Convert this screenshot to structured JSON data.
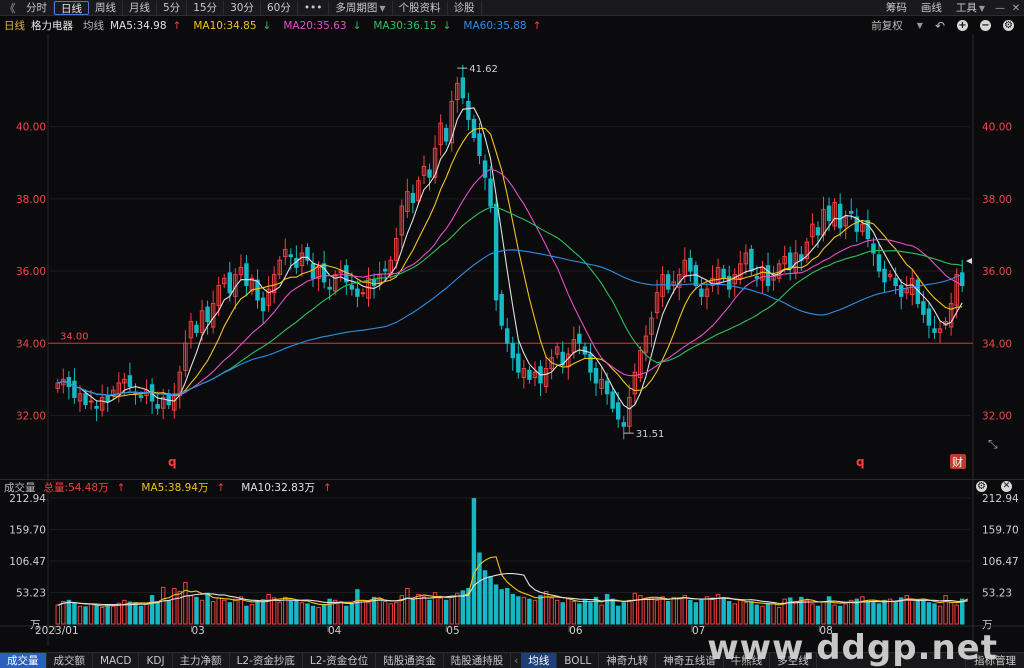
{
  "toolbar": {
    "back": "《",
    "items": [
      "分时",
      "日线",
      "周线",
      "月线",
      "5分",
      "15分",
      "30分",
      "60分",
      "•••",
      "多周期图",
      "个股资料",
      "诊股"
    ],
    "active_index": 1,
    "right_items": [
      "筹码",
      "画线",
      "工具"
    ]
  },
  "header": {
    "period": "日线",
    "stock_name": "格力电器",
    "avg_label": "均线",
    "ma": [
      {
        "label": "MA5:34.98",
        "arrow": "↑",
        "color": "#e0e0e0"
      },
      {
        "label": "MA10:34.85",
        "arrow": "↓",
        "color": "#f0c419"
      },
      {
        "label": "MA20:35.63",
        "arrow": "↓",
        "color": "#e44fc7"
      },
      {
        "label": "MA30:36.15",
        "arrow": "↓",
        "color": "#2ec05c"
      },
      {
        "label": "MA60:35.88",
        "arrow": "↑",
        "color": "#2e8fe8"
      }
    ],
    "adjust": "前复权"
  },
  "price_axis": {
    "ticks": [
      "40.00",
      "38.00",
      "36.00",
      "34.00",
      "32.00"
    ],
    "min": 30.6,
    "max": 42.4
  },
  "annotations": {
    "high": "41.62",
    "low": "31.51",
    "ref_line": "34.00",
    "q1": "q",
    "q2": "q",
    "cai": "财"
  },
  "volume": {
    "label": "成交量",
    "total": "总量:54.48万",
    "total_arrow": "↑",
    "ma5": "MA5:38.94万",
    "ma5_arrow": "↑",
    "ma10": "MA10:32.83万",
    "ma10_arrow": "↑",
    "ticks": [
      "212.94",
      "159.70",
      "106.47",
      "53.23"
    ],
    "unit": "万",
    "max": 212.94
  },
  "x_labels": [
    "2023/01",
    "03",
    "04",
    "05",
    "06",
    "07",
    "08"
  ],
  "tabs": [
    "成交量",
    "成交额",
    "MACD",
    "KDJ",
    "主力净额",
    "L2-资金抄底",
    "L2-资金仓位",
    "陆股通资金",
    "陆股通持股"
  ],
  "tabs2": [
    "均线",
    "BOLL",
    "神奇九转",
    "神奇五线谱",
    "牛熊线",
    "多空线"
  ],
  "tab_more": "指标管理",
  "watermark": "www.ddgp.net",
  "colors": {
    "up": "#f04141",
    "down": "#17b8c4",
    "ma5": "#e0e0e0",
    "ma10": "#f0c419",
    "ma20": "#e44fc7",
    "ma30": "#2ec05c",
    "ma60": "#2e8fe8"
  },
  "chart_data": {
    "type": "candlestick",
    "x_start": "2023/01",
    "ylim": [
      30.6,
      42.4
    ],
    "closes": [
      32.9,
      33.0,
      32.8,
      32.5,
      32.6,
      32.3,
      32.4,
      32.2,
      32.5,
      32.4,
      32.7,
      32.9,
      33.0,
      32.8,
      32.6,
      32.5,
      32.7,
      32.4,
      32.2,
      32.5,
      32.3,
      32.6,
      33.2,
      34.0,
      34.6,
      34.3,
      34.9,
      34.6,
      35.1,
      35.6,
      35.8,
      35.4,
      35.9,
      36.1,
      35.6,
      35.8,
      35.2,
      34.9,
      35.5,
      35.9,
      36.3,
      36.6,
      36.4,
      36.1,
      36.5,
      36.3,
      35.8,
      36.1,
      35.7,
      35.5,
      35.9,
      36.0,
      35.7,
      35.5,
      35.3,
      35.4,
      35.8,
      35.6,
      35.9,
      36.0,
      36.3,
      36.9,
      37.8,
      38.2,
      37.9,
      38.5,
      38.9,
      38.6,
      39.4,
      40.1,
      39.6,
      40.7,
      41.2,
      40.8,
      40.2,
      39.7,
      39.2,
      38.6,
      37.8,
      35.2,
      34.5,
      34.0,
      33.6,
      33.2,
      33.3,
      33.0,
      33.2,
      32.9,
      33.3,
      33.6,
      33.9,
      33.4,
      33.7,
      34.1,
      34.0,
      33.7,
      33.2,
      32.9,
      33.0,
      32.6,
      32.2,
      31.9,
      31.7,
      32.5,
      33.2,
      33.8,
      34.2,
      34.7,
      35.4,
      35.9,
      35.5,
      35.7,
      35.9,
      36.3,
      36.0,
      35.6,
      35.3,
      35.5,
      35.8,
      36.1,
      35.8,
      35.5,
      35.9,
      36.2,
      36.5,
      36.0,
      35.8,
      36.1,
      35.6,
      35.9,
      36.2,
      36.4,
      36.1,
      36.5,
      36.3,
      36.8,
      37.3,
      37.0,
      37.7,
      37.4,
      37.9,
      37.2,
      37.5,
      37.6,
      37.1,
      37.3,
      36.9,
      36.5,
      36.0,
      35.7,
      35.9,
      35.6,
      35.3,
      35.5,
      35.8,
      35.1,
      34.8,
      34.5,
      34.3,
      34.4,
      34.6,
      35.1,
      35.9,
      35.6
    ],
    "volumes": [
      32,
      38,
      40,
      35,
      30,
      29,
      34,
      31,
      28,
      33,
      30,
      35,
      40,
      37,
      36,
      30,
      34,
      48,
      38,
      62,
      39,
      60,
      55,
      70,
      48,
      45,
      40,
      52,
      38,
      44,
      40,
      36,
      42,
      46,
      30,
      33,
      38,
      41,
      50,
      44,
      37,
      45,
      40,
      39,
      36,
      34,
      30,
      28,
      33,
      42,
      40,
      38,
      30,
      33,
      58,
      40,
      36,
      45,
      42,
      38,
      34,
      36,
      48,
      60,
      42,
      50,
      46,
      40,
      53,
      44,
      40,
      47,
      52,
      56,
      60,
      212,
      120,
      90,
      80,
      66,
      58,
      60,
      50,
      46,
      45,
      42,
      40,
      48,
      55,
      44,
      40,
      36,
      42,
      38,
      34,
      40,
      36,
      45,
      32,
      50,
      42,
      30,
      36,
      40,
      52,
      48,
      42,
      44,
      40,
      46,
      38,
      45,
      44,
      48,
      40,
      36,
      42,
      46,
      44,
      50,
      42,
      38,
      34,
      40,
      36,
      38,
      32,
      30,
      35,
      36,
      28,
      42,
      44,
      38,
      45,
      40,
      34,
      30,
      38,
      46,
      32,
      30,
      34,
      40,
      42,
      46,
      38,
      36,
      34,
      40,
      42,
      36,
      44,
      48,
      40,
      38,
      42,
      36,
      34,
      30,
      48,
      36,
      32,
      42,
      54
    ]
  }
}
